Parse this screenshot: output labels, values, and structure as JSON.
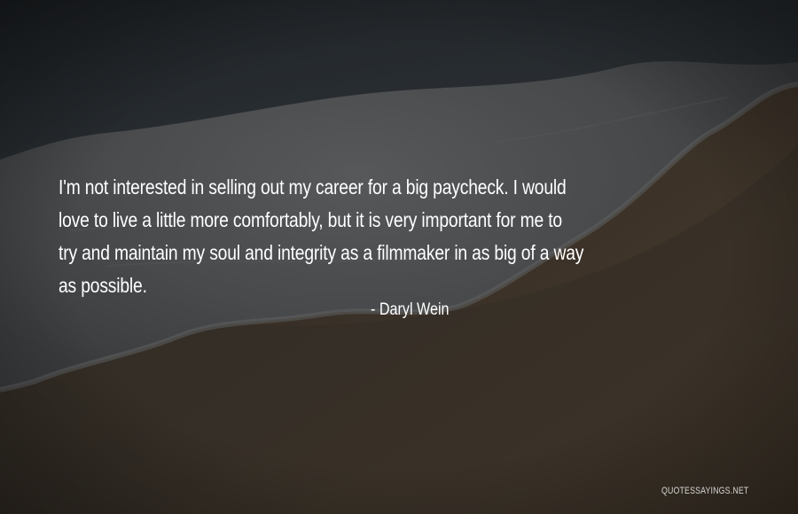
{
  "quote": {
    "lines": [
      "I'm not interested in selling out my career for a big paycheck. I would",
      "love to live a little more comfortably, but it is very important for me to",
      "try and maintain my soul and integrity as a filmmaker in as big of a way",
      "as possible."
    ],
    "author": "- Daryl Wein"
  },
  "watermark": "QUOTESSAYINGS.NET",
  "colors": {
    "text": "#ffffff",
    "sea_dark": "#1c2024",
    "foam": "#4a4c4e",
    "wet_sand": "#2c2a26",
    "dry_sand": "#4a3c2a"
  }
}
